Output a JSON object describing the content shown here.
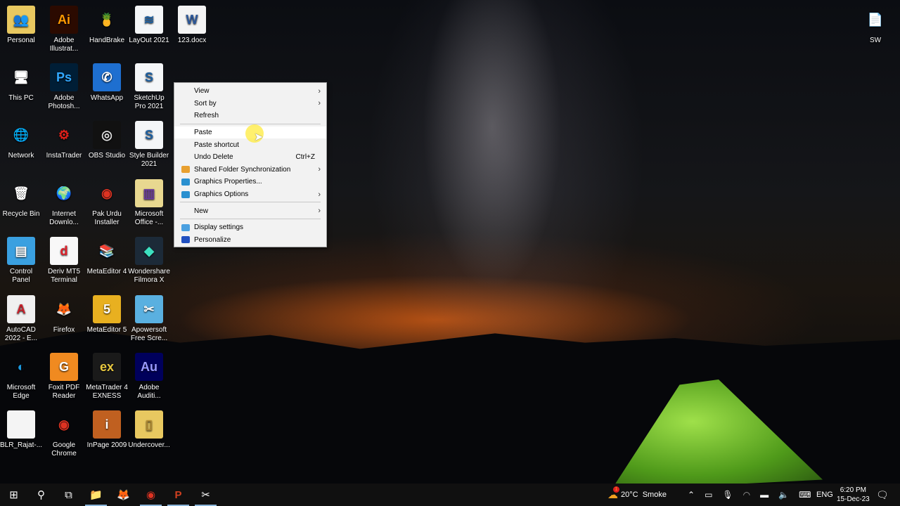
{
  "desktop_icons": [
    {
      "label": "Personal",
      "color": "#e8c860",
      "glyph": "👥"
    },
    {
      "label": "Adobe Illustrat...",
      "color": "#2b0a00",
      "glyph": "Ai",
      "fg": "#ff9a00"
    },
    {
      "label": "HandBrake",
      "color": "transparent",
      "glyph": "🍍"
    },
    {
      "label": "LayOut 2021",
      "color": "#f4f6f8",
      "glyph": "≋",
      "fg": "#1d5fa0"
    },
    {
      "label": "123.docx",
      "color": "#f4f4f4",
      "glyph": "W",
      "fg": "#2b579a"
    },
    {
      "label": "This PC",
      "color": "transparent",
      "glyph": "🖥"
    },
    {
      "label": "Adobe Photosh...",
      "color": "#001e36",
      "glyph": "Ps",
      "fg": "#31a8ff"
    },
    {
      "label": "WhatsApp",
      "color": "#1e6fd0",
      "glyph": "✆",
      "fg": "#fff"
    },
    {
      "label": "SketchUp Pro 2021",
      "color": "#f4f6f8",
      "glyph": "S",
      "fg": "#1d5fa0"
    },
    {
      "label": "Network",
      "color": "transparent",
      "glyph": "🌐"
    },
    {
      "label": "InstaTrader",
      "color": "transparent",
      "glyph": "⚙",
      "fg": "#e0201a"
    },
    {
      "label": "OBS Studio",
      "color": "#111",
      "glyph": "◎",
      "fg": "#ddd"
    },
    {
      "label": "Style Builder 2021",
      "color": "#f4f6f8",
      "glyph": "S",
      "fg": "#1d5fa0"
    },
    {
      "label": "Recycle Bin",
      "color": "transparent",
      "glyph": "🗑"
    },
    {
      "label": "Internet Downlo...",
      "color": "transparent",
      "glyph": "🌍"
    },
    {
      "label": "Pak Urdu Installer",
      "color": "transparent",
      "glyph": "◉",
      "fg": "#dd3322"
    },
    {
      "label": "Microsoft Office -...",
      "color": "#e8d890",
      "glyph": "▥",
      "fg": "#6a3aa0"
    },
    {
      "label": "Control Panel",
      "color": "#3aa0e0",
      "glyph": "▤",
      "fg": "#fff"
    },
    {
      "label": "Deriv MT5 Terminal",
      "color": "#f8f8f8",
      "glyph": "d",
      "fg": "#e0202a"
    },
    {
      "label": "MetaEditor 4",
      "color": "transparent",
      "glyph": "📚"
    },
    {
      "label": "Wondershare Filmora X",
      "color": "#1c2a38",
      "glyph": "◆",
      "fg": "#3de0c0"
    },
    {
      "label": "AutoCAD 2022 - E...",
      "color": "#f0f0f0",
      "glyph": "A",
      "fg": "#c8202a"
    },
    {
      "label": "Firefox",
      "color": "transparent",
      "glyph": "🦊"
    },
    {
      "label": "MetaEditor 5",
      "color": "#e8b020",
      "glyph": "5",
      "fg": "#fff"
    },
    {
      "label": "Apowersoft Free Scre...",
      "color": "#5ab0e0",
      "glyph": "✂",
      "fg": "#fff"
    },
    {
      "label": "Microsoft Edge",
      "color": "transparent",
      "glyph": "◐",
      "fg": "#1a9ae0"
    },
    {
      "label": "Foxit PDF Reader",
      "color": "#f08a20",
      "glyph": "G",
      "fg": "#fff"
    },
    {
      "label": "MetaTrader 4 EXNESS",
      "color": "#1a1a1a",
      "glyph": "ex",
      "fg": "#e8c840"
    },
    {
      "label": "Adobe Auditi...",
      "color": "#00005b",
      "glyph": "Au",
      "fg": "#9999ff"
    },
    {
      "label": "BLR_Rajat-...",
      "color": "#f4f4f4",
      "glyph": ""
    },
    {
      "label": "Google Chrome",
      "color": "transparent",
      "glyph": "◉",
      "fg": "#dd3322"
    },
    {
      "label": "InPage 2009",
      "color": "#c06020",
      "glyph": "i",
      "fg": "#fff"
    },
    {
      "label": "Undercover...",
      "color": "#e8c860",
      "glyph": "▯",
      "fg": "#b08a30"
    },
    {
      "label": "SW",
      "color": "transparent",
      "glyph": "📄"
    }
  ],
  "context_menu": {
    "items": [
      {
        "label": "View",
        "submenu": true
      },
      {
        "label": "Sort by",
        "submenu": true
      },
      {
        "label": "Refresh"
      },
      {
        "sep": true
      },
      {
        "label": "Paste",
        "highlighted": true
      },
      {
        "label": "Paste shortcut"
      },
      {
        "label": "Undo Delete",
        "shortcut": "Ctrl+Z"
      },
      {
        "label": "Shared Folder Synchronization",
        "submenu": true,
        "icon": "#e8a030"
      },
      {
        "label": "Graphics Properties...",
        "icon": "#2a90d0"
      },
      {
        "label": "Graphics Options",
        "submenu": true,
        "icon": "#2a90d0"
      },
      {
        "sep": true
      },
      {
        "label": "New",
        "submenu": true
      },
      {
        "sep": true
      },
      {
        "label": "Display settings",
        "icon": "#4aa0e0"
      },
      {
        "label": "Personalize",
        "icon": "#2050c0"
      }
    ]
  },
  "taskbar": {
    "pinned": [
      {
        "name": "start",
        "glyph": "⊞"
      },
      {
        "name": "search",
        "glyph": "⚲"
      },
      {
        "name": "task-view",
        "glyph": "⧉"
      },
      {
        "name": "file-explorer",
        "glyph": "📁",
        "open": true
      },
      {
        "name": "firefox",
        "glyph": "🦊"
      },
      {
        "name": "chrome",
        "glyph": "◉",
        "open": true
      },
      {
        "name": "powerpoint",
        "glyph": "P",
        "open": true
      },
      {
        "name": "apowersoft",
        "glyph": "✂",
        "open": true
      }
    ],
    "weather": {
      "temp": "20°C",
      "condition": "Smoke",
      "badge": "1"
    },
    "language": "ENG",
    "time": "6:20 PM",
    "date": "15-Dec-23"
  }
}
